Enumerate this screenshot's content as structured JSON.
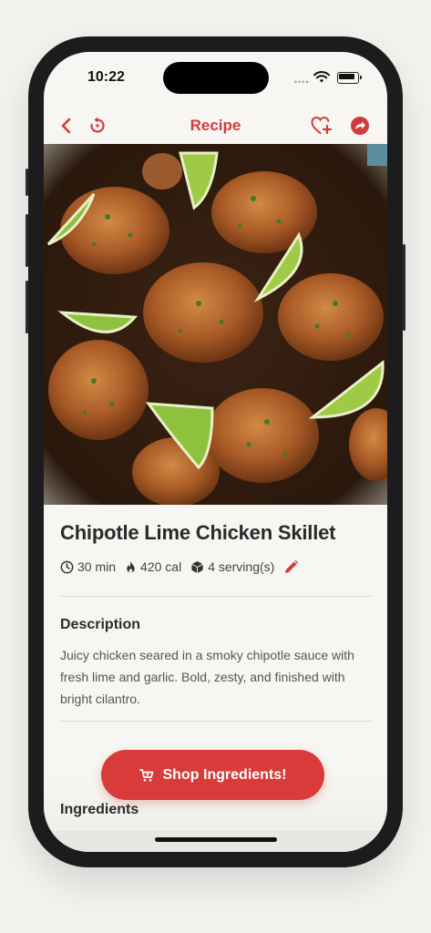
{
  "status_bar": {
    "time": "10:22"
  },
  "nav": {
    "title": "Recipe",
    "back_icon": "chevron-left-icon",
    "refresh_icon": "refresh-icon",
    "favorite_icon": "heart-plus-icon",
    "share_icon": "share-icon"
  },
  "recipe": {
    "title": "Chipotle Lime Chicken Skillet",
    "time": "30 min",
    "calories": "420 cal",
    "servings": "4 serving(s)",
    "description_heading": "Description",
    "description": "Juicy chicken seared in a smoky chipotle sauce with fresh lime and garlic. Bold, zesty, and finished with bright cilantro.",
    "ingredients_heading": "Ingredients"
  },
  "cta": {
    "shop_label": "Shop Ingredients!"
  },
  "colors": {
    "accent": "#d93a3a",
    "title": "#2a2a2a",
    "background": "#f7f6f2"
  }
}
